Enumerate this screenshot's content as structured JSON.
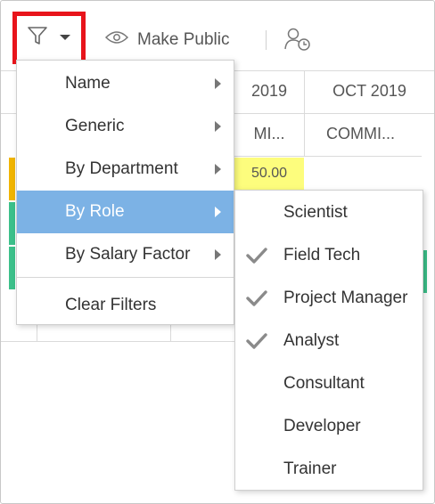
{
  "toolbar": {
    "filter_icon": "filter-funnel-icon",
    "dropdown_icon": "caret-down-icon",
    "make_public_label": "Make Public",
    "make_public_icon": "eye-icon",
    "user_schedule_icon": "user-clock-icon",
    "highlight_color": "#e8141b"
  },
  "grid": {
    "months": [
      "2019",
      "OCT 2019"
    ],
    "commitment_labels": [
      "MI...",
      "COMMI..."
    ],
    "highlighted_value": "50.00",
    "highlight_color": "#fdfd7d",
    "strip_colors": [
      "#f0b400",
      "#3cc08a",
      "#3cc08a",
      "#3cc08a"
    ]
  },
  "menu": {
    "items": [
      {
        "label": "Name",
        "has_submenu": true,
        "active": false
      },
      {
        "label": "Generic",
        "has_submenu": true,
        "active": false
      },
      {
        "label": "By Department",
        "has_submenu": true,
        "active": false
      },
      {
        "label": "By Role",
        "has_submenu": true,
        "active": true
      },
      {
        "label": "By Salary Factor",
        "has_submenu": true,
        "active": false
      }
    ],
    "clear_label": "Clear Filters",
    "active_color": "#7cb2e5"
  },
  "submenu": {
    "items": [
      {
        "label": "Scientist",
        "checked": false
      },
      {
        "label": "Field Tech",
        "checked": true
      },
      {
        "label": "Project Manager",
        "checked": true
      },
      {
        "label": "Analyst",
        "checked": true
      },
      {
        "label": "Consultant",
        "checked": false
      },
      {
        "label": "Developer",
        "checked": false
      },
      {
        "label": "Trainer",
        "checked": false
      }
    ]
  }
}
